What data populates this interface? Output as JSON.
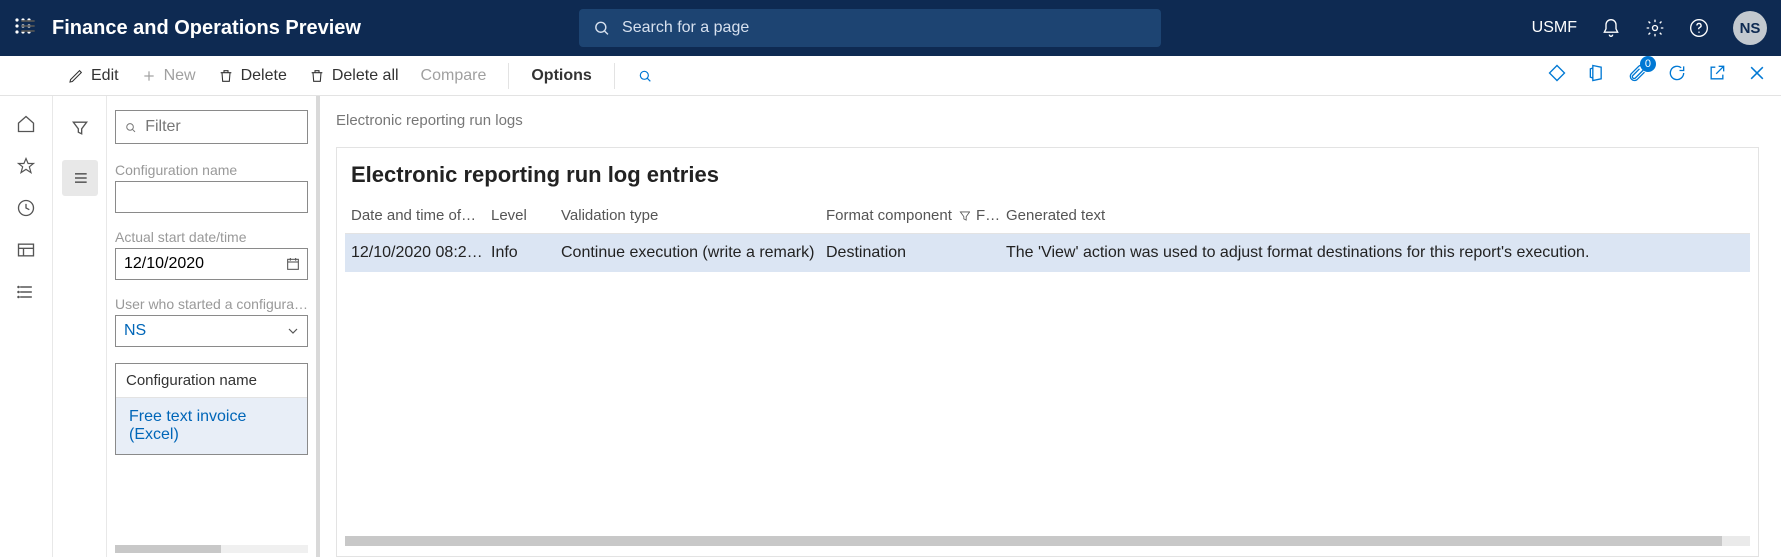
{
  "header": {
    "app_title": "Finance and Operations Preview",
    "search_placeholder": "Search for a page",
    "legal_entity": "USMF",
    "avatar_initials": "NS",
    "attachment_badge": "0"
  },
  "actions": {
    "edit": "Edit",
    "new": "New",
    "delete": "Delete",
    "delete_all": "Delete all",
    "compare": "Compare",
    "options": "Options"
  },
  "side": {
    "filter_placeholder": "Filter",
    "config_label": "Configuration name",
    "config_value": "",
    "start_label": "Actual start date/time",
    "start_value": "12/10/2020",
    "user_label": "User who started a configuration",
    "user_value": "NS",
    "list_header": "Configuration name",
    "list_item": "Free text invoice (Excel)"
  },
  "main": {
    "breadcrumb": "Electronic reporting run logs",
    "card_title": "Electronic reporting run log entries",
    "columns": {
      "date": "Date and time of…",
      "level": "Level",
      "vtype": "Validation type",
      "fcomp": "Format component",
      "fdots": "F…",
      "gtext": "Generated text"
    },
    "rows": [
      {
        "date": "12/10/2020 08:2…",
        "level": "Info",
        "vtype": "Continue execution (write a remark)",
        "fcomp": "Destination",
        "fdots": "",
        "gtext": "The 'View' action was used to adjust format destinations for this report's execution."
      }
    ]
  }
}
